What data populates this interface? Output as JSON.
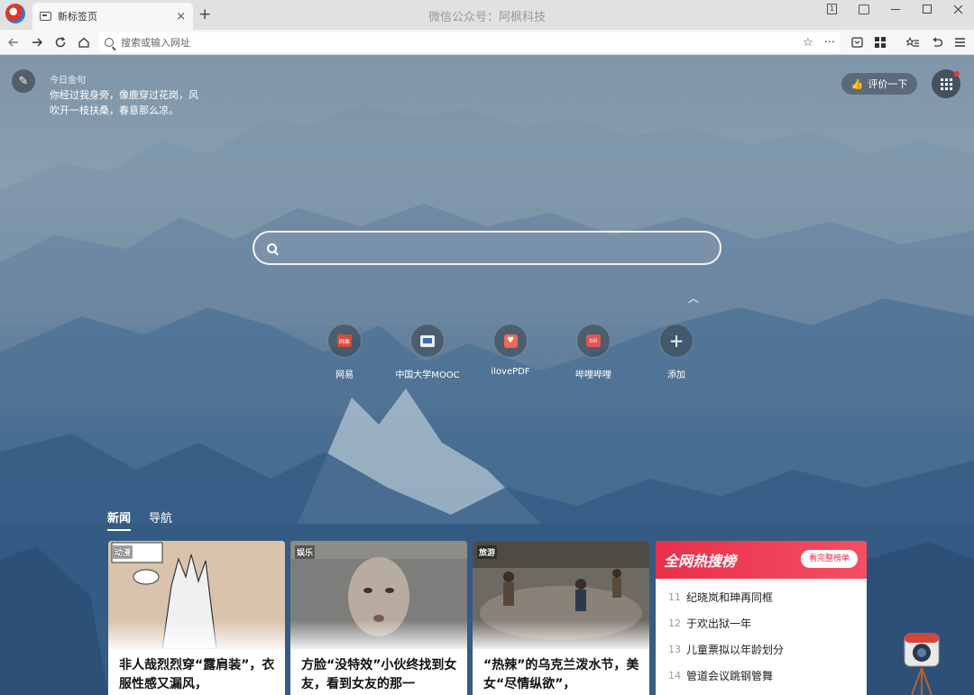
{
  "window": {
    "title": "微信公众号：阿枫科技",
    "tab_title": "新标签页",
    "tab_close": "×",
    "new_tab": "+",
    "tab_count": "1"
  },
  "addressbar": {
    "placeholder": "搜索或输入网址",
    "more": "···"
  },
  "quote": {
    "label": "今日金句",
    "text": "你经过我身旁，像鹿穿过花岗，风吹开一枝扶桑，春意那么凉。"
  },
  "rate_button": "评价一下",
  "shortcuts": [
    {
      "label": "网易",
      "icon": "netease-icon",
      "icon_text": "网易"
    },
    {
      "label": "中国大学MOOC",
      "icon": "mooc-icon",
      "icon_text": ""
    },
    {
      "label": "ilovePDF",
      "icon": "ilovepdf-icon",
      "icon_text": "♥"
    },
    {
      "label": "哔哩哔哩",
      "icon": "bilibili-icon",
      "icon_text": "bili"
    },
    {
      "label": "添加",
      "icon": "plus-icon",
      "icon_text": "+"
    }
  ],
  "news_tabs": [
    "新闻",
    "导航"
  ],
  "cards": [
    {
      "category": "动漫",
      "title": "非人哉烈烈穿“露肩装”，衣服性感又漏风，"
    },
    {
      "category": "娱乐",
      "title": "方脸“没特效”小伙终找到女友，看到女友的那一"
    },
    {
      "category": "旅游",
      "title": "“热辣”的乌克兰泼水节，美女“尽情纵欲”，"
    }
  ],
  "hot": {
    "title": "全网热搜榜",
    "more": "看完整榜单",
    "items": [
      {
        "rank": "11",
        "text": "纪晓岚和珅再同框"
      },
      {
        "rank": "12",
        "text": "于欢出狱一年"
      },
      {
        "rank": "13",
        "text": "儿童票拟以年龄划分"
      },
      {
        "rank": "14",
        "text": "管道会议跳钢管舞"
      }
    ]
  },
  "colors": {
    "accent_red": "#e8304a",
    "tabbar_bg": "#e1e1e1",
    "addressbar_bg": "#f7f7f7"
  }
}
